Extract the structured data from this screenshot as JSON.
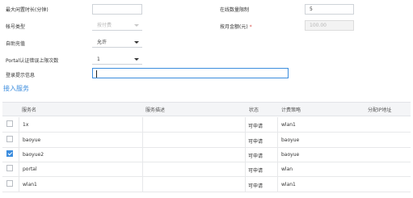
{
  "form": {
    "max_idle_label": "最大闲置时长(分钟)",
    "max_idle_value": "",
    "online_limit_label": "在线数量限制",
    "online_limit_value": "5",
    "billing_type_label": "帐号类型",
    "billing_type_value": "按付费",
    "account_amount_label": "按月金额(元)",
    "account_amount_required": "*",
    "account_amount_placeholder": "100.00",
    "self_service_label": "自助充值",
    "self_service_value": "允许",
    "portal_label": "Portal认证错误上限次数",
    "portal_value": "1",
    "login_hint_label": "登录提示信息",
    "login_hint_value": ""
  },
  "section": {
    "title": "接入服务"
  },
  "table": {
    "headers": [
      "服务名",
      "服务描述",
      "状态",
      "计费策略",
      "分配IP地址"
    ],
    "rows": [
      {
        "checked": false,
        "name": "1x",
        "desc": "",
        "status": "可申请",
        "policy": "wlan1",
        "ip": ""
      },
      {
        "checked": false,
        "name": "baoyue",
        "desc": "",
        "status": "可申请",
        "policy": "baoyue",
        "ip": ""
      },
      {
        "checked": true,
        "name": "baoyue2",
        "desc": "",
        "status": "可申请",
        "policy": "baoyue",
        "ip": ""
      },
      {
        "checked": false,
        "name": "portal",
        "desc": "",
        "status": "可申请",
        "policy": "wlan",
        "ip": ""
      },
      {
        "checked": false,
        "name": "wlan1",
        "desc": "",
        "status": "可申请",
        "policy": "wlan1",
        "ip": ""
      }
    ]
  },
  "colors": {
    "accent": "#3c8dde",
    "border": "#cfd3d8",
    "header_bg": "#f4f5f7"
  }
}
